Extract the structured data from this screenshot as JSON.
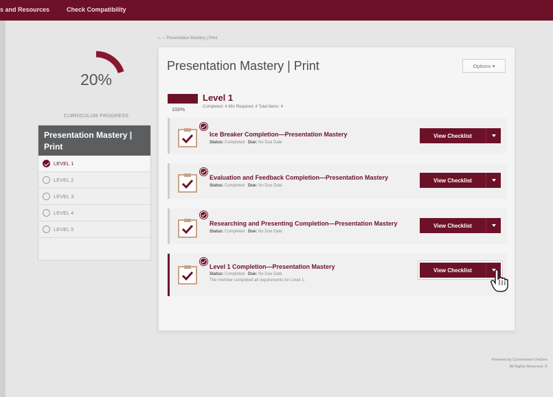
{
  "topnav": {
    "item1": "s and Resources",
    "item2": "Check Compatibility"
  },
  "progress": {
    "percent_text": "20%",
    "value": 0.2,
    "label": "CURRICULUM PROGRESS"
  },
  "sidebar": {
    "title": "Presentation Mastery | Print",
    "items": [
      {
        "label": "LEVEL 1",
        "checked": true
      },
      {
        "label": "LEVEL 2",
        "checked": false
      },
      {
        "label": "LEVEL 3",
        "checked": false
      },
      {
        "label": "LEVEL 4",
        "checked": false
      },
      {
        "label": "LEVEL 5",
        "checked": false
      }
    ]
  },
  "breadcrumb": "Presentation Mastery | Print",
  "main": {
    "title": "Presentation Mastery | Print",
    "options_label": "Options ▾",
    "level": {
      "title": "Level 1",
      "percent": "100%",
      "meta": "Completed: 4    Min Required: 4    Total Items: 4"
    },
    "cards": [
      {
        "title": "Ice Breaker Completion—Presentation Mastery",
        "status": "Completed",
        "due": "No Due Date",
        "desc": ""
      },
      {
        "title": "Evaluation and Feedback Completion—Presentation Mastery",
        "status": "Completed",
        "due": "No Due Date",
        "desc": ""
      },
      {
        "title": "Researching and Presenting Completion—Presentation Mastery",
        "status": "Completed",
        "due": "No Due Date",
        "desc": ""
      },
      {
        "title": "Level 1 Completion—Presentation Mastery",
        "status": "Completed",
        "due": "No Due Date",
        "desc": "The member completed all requirements for Level 1."
      }
    ],
    "status_label": "Status:",
    "due_label": "Due:",
    "button_label": "View Checklist"
  },
  "footer": {
    "line1": "Powered by Cornerstone OnDem",
    "line2": "All Rights Reserved. ©"
  },
  "colors": {
    "brand": "#6d1128",
    "sidebar_header": "#5b5d5f"
  }
}
